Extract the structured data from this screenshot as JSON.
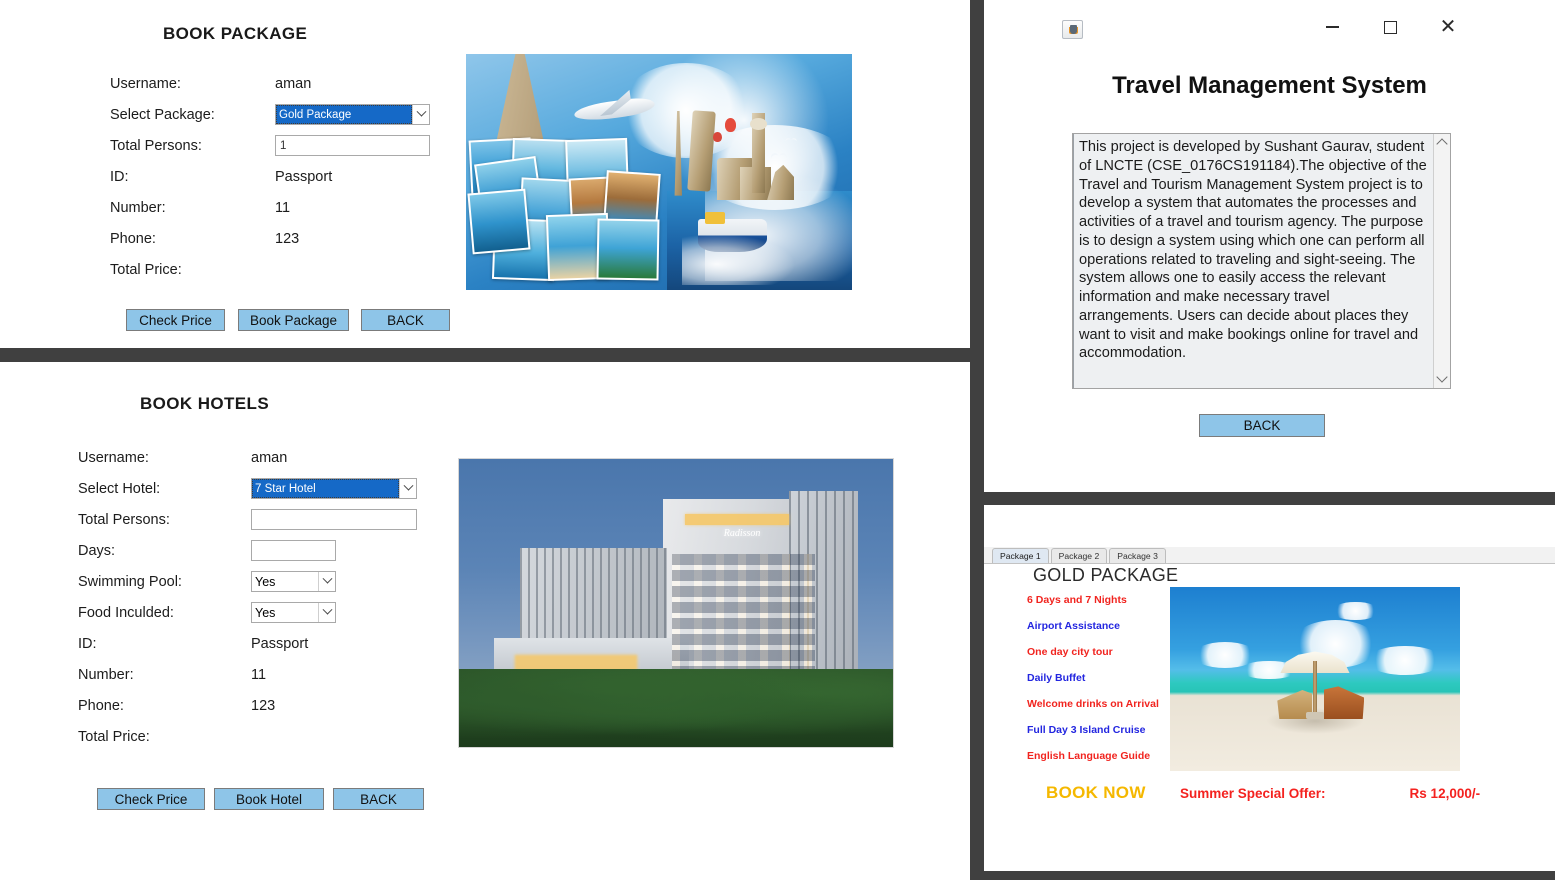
{
  "book_package": {
    "title": "BOOK PACKAGE",
    "fields": [
      {
        "label": "Username:",
        "value": "aman",
        "kind": "text"
      },
      {
        "label": "Select Package:",
        "value": "Gold Package",
        "kind": "combo"
      },
      {
        "label": "Total Persons:",
        "value": "1",
        "kind": "input"
      },
      {
        "label": "ID:",
        "value": "Passport",
        "kind": "text"
      },
      {
        "label": "Number:",
        "value": "11",
        "kind": "text"
      },
      {
        "label": "Phone:",
        "value": "123",
        "kind": "text"
      },
      {
        "label": "Total Price:",
        "value": "",
        "kind": "text"
      }
    ],
    "buttons": [
      "Check Price",
      "Book Package",
      "BACK"
    ],
    "image_alt": "travel-collage-landmarks-photos"
  },
  "book_hotels": {
    "title": "BOOK HOTELS",
    "fields": [
      {
        "label": "Username:",
        "value": "aman",
        "kind": "text"
      },
      {
        "label": "Select Hotel:",
        "value": "7 Star Hotel",
        "kind": "combo"
      },
      {
        "label": "Total Persons:",
        "value": "",
        "kind": "input"
      },
      {
        "label": "Days:",
        "value": "",
        "kind": "input-sm"
      },
      {
        "label": "Swimming Pool:",
        "value": "Yes",
        "kind": "combo-sm"
      },
      {
        "label": "Food Inculded:",
        "value": "Yes",
        "kind": "combo-sm"
      },
      {
        "label": "ID:",
        "value": "Passport",
        "kind": "text"
      },
      {
        "label": "Number:",
        "value": "11",
        "kind": "text"
      },
      {
        "label": "Phone:",
        "value": "123",
        "kind": "text"
      },
      {
        "label": "Total Price:",
        "value": "",
        "kind": "text"
      }
    ],
    "buttons": [
      "Check Price",
      "Book Hotel",
      "BACK"
    ],
    "image_alt": "radisson-hotel-exterior-dusk"
  },
  "tms": {
    "window_icon": "java-cup-icon",
    "window_controls": [
      "minimize",
      "maximize",
      "close"
    ],
    "title": "Travel Management System",
    "description": "This project is developed by Sushant Gaurav, student of LNCTE (CSE_0176CS191184).The objective of the Travel and Tourism Management System project is to develop a system that automates the processes and activities of a travel and tourism agency. The purpose is to design a system using which one can perform all operations related to traveling and sight-seeing. The system allows one to easily access the relevant information and make necessary travel arrangements. Users can decide about places they want to visit and make bookings online for travel and accommodation.",
    "back_button": "BACK",
    "scrollbar": {
      "up": "chevron-up",
      "down": "chevron-down"
    }
  },
  "gold_package": {
    "tabs": [
      {
        "label": "Package 1",
        "active": true
      },
      {
        "label": "Package 2",
        "active": false
      },
      {
        "label": "Package 3",
        "active": false
      }
    ],
    "title": "GOLD PACKAGE",
    "features": [
      {
        "text": "6 Days and 7 Nights",
        "color": "#f1241f"
      },
      {
        "text": "Airport Assistance",
        "color": "#2326e0"
      },
      {
        "text": "One day city tour",
        "color": "#f1241f"
      },
      {
        "text": "Daily Buffet",
        "color": "#2326e0"
      },
      {
        "text": "Welcome drinks on Arrival",
        "color": "#f1241f"
      },
      {
        "text": "Full Day 3 Island Cruise",
        "color": "#2326e0"
      },
      {
        "text": "English Language Guide",
        "color": "#f1241f"
      }
    ],
    "book_now": "BOOK NOW",
    "offer_label": "Summer Special Offer:",
    "offer_price": "Rs 12,000/-",
    "image_alt": "tropical-beach-umbrella-loungers"
  },
  "colors": {
    "button_blue": "#8ec5e8",
    "gutter": "#404040",
    "combo_highlight": "#1569c7",
    "feature_red": "#f1241f",
    "feature_blue": "#2326e0",
    "book_now_gold": "#f5b800",
    "offer_red": "#f4221f"
  }
}
